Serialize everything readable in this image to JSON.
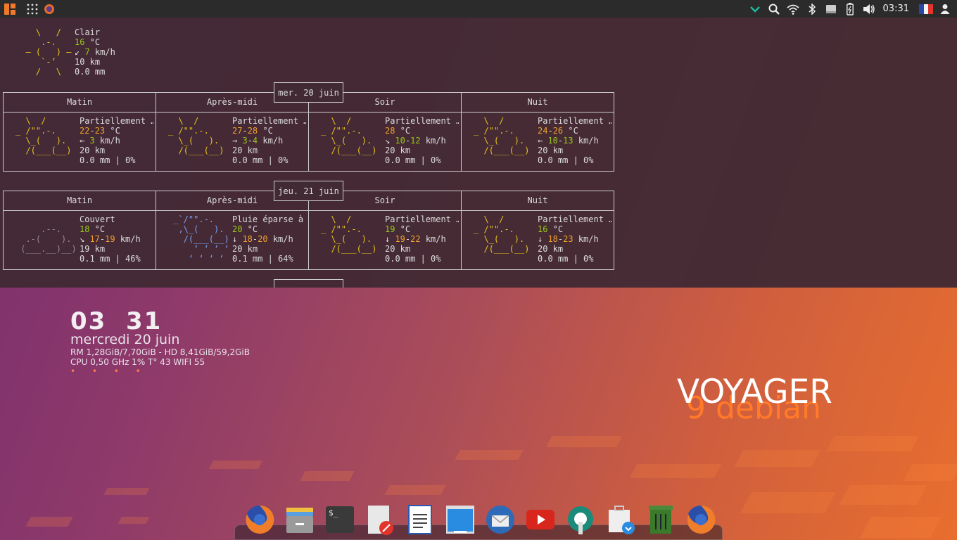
{
  "topbar": {
    "clock": "03:31"
  },
  "current": {
    "art": "    \\   /    \n     .-.     \n  ― (   ) ―  \n     `-’     \n    /   \\    ",
    "condition": "Clair",
    "temp_value": "16",
    "temp_unit": " °C",
    "wind_arrow": "↙ ",
    "wind_value": "7",
    "wind_unit": " km/h",
    "visibility": "10 km",
    "precip": "0.0 mm"
  },
  "days": [
    {
      "date": "mer. 20 juin",
      "periods": [
        {
          "label": "Matin",
          "condition": "Partiellement …",
          "temp_lo": "22",
          "temp_hi": "23",
          "temp_unit": " °C",
          "wind_arrow": "← ",
          "wind_lo": "3",
          "wind_hi": "",
          "wind_unit": " km/h",
          "visibility": "20 km",
          "precip": "0.0 mm | 0%",
          "art": "partly"
        },
        {
          "label": "Après-midi",
          "condition": "Partiellement …",
          "temp_lo": "27",
          "temp_hi": "28",
          "temp_unit": " °C",
          "wind_arrow": "→ ",
          "wind_lo": "3",
          "wind_hi": "4",
          "wind_unit": " km/h",
          "visibility": "20 km",
          "precip": "0.0 mm | 0%",
          "art": "partly"
        },
        {
          "label": "Soir",
          "condition": "Partiellement …",
          "temp_lo": "28",
          "temp_hi": "",
          "temp_unit": " °C",
          "wind_arrow": "↘ ",
          "wind_lo": "10",
          "wind_hi": "12",
          "wind_unit": " km/h",
          "visibility": "20 km",
          "precip": "0.0 mm | 0%",
          "art": "partly"
        },
        {
          "label": "Nuit",
          "condition": "Partiellement …",
          "temp_lo": "24",
          "temp_hi": "26",
          "temp_unit": " °C",
          "wind_arrow": "← ",
          "wind_lo": "10",
          "wind_hi": "13",
          "wind_unit": " km/h",
          "visibility": "20 km",
          "precip": "0.0 mm | 0%",
          "art": "partly"
        }
      ]
    },
    {
      "date": "jeu. 21 juin",
      "periods": [
        {
          "label": "Matin",
          "condition": "Couvert",
          "temp_lo": "18",
          "temp_hi": "",
          "temp_unit": " °C",
          "wind_arrow": "↘ ",
          "wind_lo": "17",
          "wind_hi": "19",
          "wind_unit": " km/h",
          "visibility": "19 km",
          "precip": "0.1 mm | 46%",
          "art": "cloudy"
        },
        {
          "label": "Après-midi",
          "condition": "Pluie éparse à",
          "temp_lo": "20",
          "temp_hi": "",
          "temp_unit": " °C",
          "wind_arrow": "↓ ",
          "wind_lo": "18",
          "wind_hi": "20",
          "wind_unit": " km/h",
          "visibility": "20 km",
          "precip": "0.1 mm | 64%",
          "art": "rain"
        },
        {
          "label": "Soir",
          "condition": "Partiellement …",
          "temp_lo": "19",
          "temp_hi": "",
          "temp_unit": " °C",
          "wind_arrow": "↓ ",
          "wind_lo": "19",
          "wind_hi": "22",
          "wind_unit": " km/h",
          "visibility": "20 km",
          "precip": "0.0 mm | 0%",
          "art": "partly"
        },
        {
          "label": "Nuit",
          "condition": "Partiellement …",
          "temp_lo": "16",
          "temp_hi": "",
          "temp_unit": " °C",
          "wind_arrow": "↓ ",
          "wind_lo": "18",
          "wind_hi": "23",
          "wind_unit": " km/h",
          "visibility": "20 km",
          "precip": "0.0 mm | 0%",
          "art": "partly"
        }
      ]
    }
  ],
  "conky": {
    "hour": "03",
    "minute": "31",
    "date": "mercredi 20 juin",
    "ram_disk": "RM 1,28GiB/7,70GiB - HD 8,41GiB/59,2GiB",
    "cpu": "CPU 0,50 GHz 1% T° 43  WIFI 55",
    "dots": "• • • •"
  },
  "brand": {
    "voyager": "VOYAGER",
    "debian": "9 debian"
  },
  "colors": {
    "temp_green": "#98c81a",
    "temp_orange": "#f1a02a",
    "sun_yellow": "#e8c41c",
    "accent_orange": "#ff7a2a"
  },
  "dock": [
    "firefox-icon",
    "file-manager-icon",
    "terminal-icon",
    "text-editor-icon",
    "writer-document-icon",
    "window-manager-icon",
    "thunderbird-icon",
    "youtube-icon",
    "settings-tool-icon",
    "software-installer-icon",
    "trash-icon",
    "firefox-alt-icon"
  ]
}
